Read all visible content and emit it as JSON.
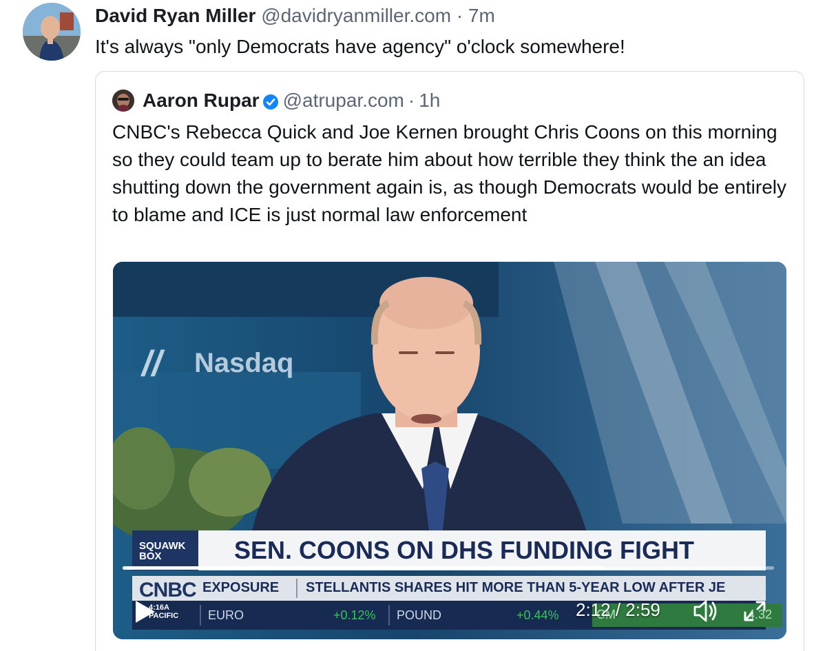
{
  "post": {
    "author_name": "David Ryan Miller",
    "author_handle": "@davidryanmiller.com",
    "separator": "·",
    "time": "7m",
    "text": "It's always \"only Democrats have agency\" o'clock somewhere!"
  },
  "quote": {
    "author_name": "Aaron Rupar",
    "verified": true,
    "author_handle": "@atrupar.com",
    "separator": "·",
    "time": "1h",
    "text": "CNBC's Rebecca Quick and Joe Kernen brought Chris Coons on this morning so they could team up to berate him about how terrible they think the an idea shutting down the government again is, as though Democrats would be entirely to blame and ICE is just normal law enforcement",
    "video": {
      "background_sign": "Nasdaq",
      "show_badge_line1": "SQUAWK",
      "show_badge_line2": "BOX",
      "headline": "SEN. COONS ON DHS FUNDING FIGHT",
      "network_logo": "CNBC",
      "clock_time": "4:16A",
      "clock_zone": "PACIFIC",
      "ticker_label": "EXPOSURE",
      "ticker_text": "STELLANTIS SHARES HIT MORE THAN 5-YEAR LOW AFTER JE",
      "markets": [
        {
          "label": "EURO",
          "value": "+0.12%"
        },
        {
          "label": "POUND",
          "value": "+0.44%"
        }
      ],
      "market_chip": "CM",
      "market_chip_value": "4.32",
      "current_time": "2:12",
      "duration": "2:59",
      "time_separator": " / ",
      "progress_fraction": 0.74,
      "icons": {
        "play": "play-icon",
        "volume": "volume-icon",
        "fullscreen": "fullscreen-icon",
        "verified": "verified-check-icon"
      }
    }
  },
  "colors": {
    "verified_blue": "#1185fe",
    "handle_gray": "#5c6672",
    "card_border": "#d6dbe1",
    "cnbc_navy": "#1b2b57",
    "market_green": "#3cc25a"
  }
}
